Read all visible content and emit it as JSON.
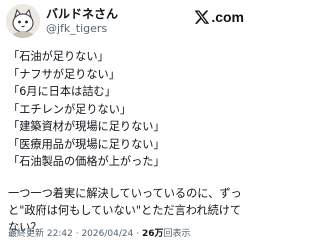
{
  "author": {
    "display_name": "バルドネさん",
    "handle": "@jfk_tigers",
    "avatar_icon": "cartoon-cat-avatar"
  },
  "brand": {
    "logo_text": ".com",
    "logo_icon": "x-logo-icon"
  },
  "tweet": {
    "lines": [
      "「石油が足りない」",
      "「ナフサが足りない」",
      "「6月に日本は詰む」",
      "「エチレンが足りない」",
      "「建築資材が現場に足りない」",
      "「医療用品が現場に足りない」",
      "「石油製品の価格が上がった」"
    ],
    "paragraph": "一つ一つ着実に解決していっているのに、ずっと\"政府は何もしていない\"とただ言われ続けてない？"
  },
  "meta": {
    "time": "最終更新 22:42",
    "separator": "·",
    "date": "2026/04/24",
    "views_count": "26万",
    "views_label": "回表示"
  }
}
